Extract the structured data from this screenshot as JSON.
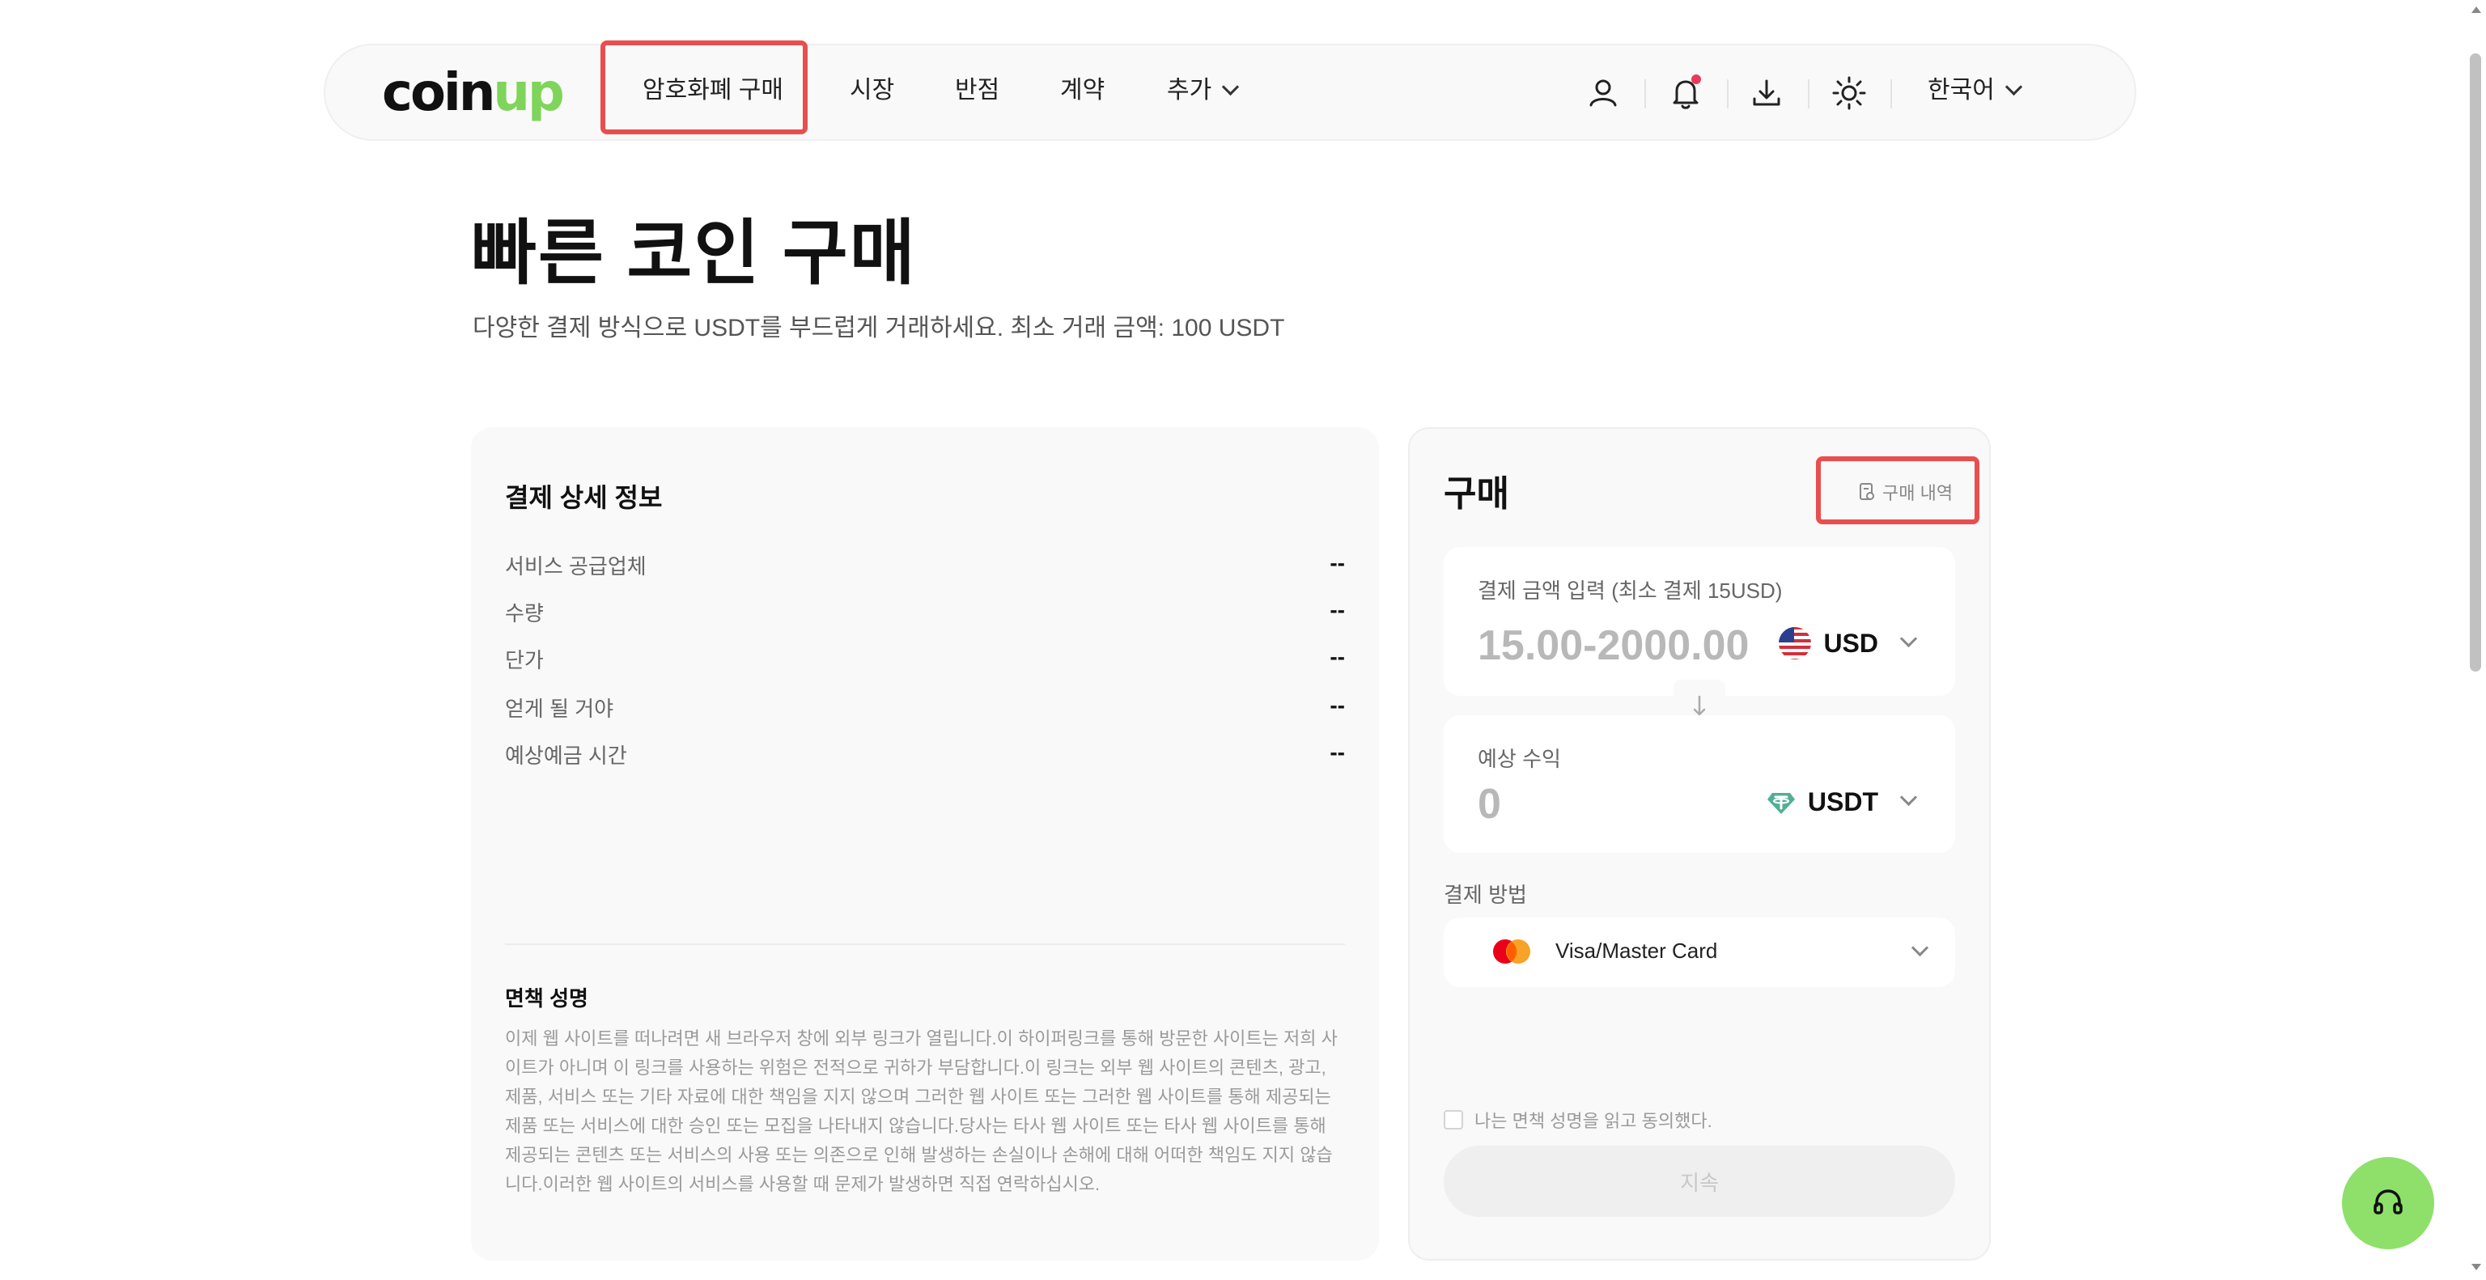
{
  "nav": {
    "logo_coin": "coin",
    "logo_up": "up",
    "items": [
      "암호화폐 구매",
      "시장",
      "반점",
      "계약",
      "추가"
    ],
    "language": "한국어"
  },
  "header": {
    "title": "빠른 코인 구매",
    "subtitle": "다양한 결제 방식으로 USDT를 부드럽게 거래하세요. 최소 거래 금액: 100 USDT"
  },
  "details": {
    "title": "결제 상세 정보",
    "rows": [
      {
        "label": "서비스 공급업체",
        "value": "--"
      },
      {
        "label": "수량",
        "value": "--"
      },
      {
        "label": "단가",
        "value": "--"
      },
      {
        "label": "얻게 될 거야",
        "value": "--"
      },
      {
        "label": "예상예금 시간",
        "value": "--"
      }
    ],
    "disclaimer_title": "면책 성명",
    "disclaimer_text": "이제 웹 사이트를 떠나려면 새 브라우저 창에 외부 링크가 열립니다.이 하이퍼링크를 통해 방문한 사이트는 저희 사이트가 아니며 이 링크를 사용하는 위험은 전적으로 귀하가 부담합니다.이 링크는 외부 웹 사이트의 콘텐츠, 광고, 제품, 서비스 또는 기타 자료에 대한 책임을 지지 않으며 그러한 웹 사이트 또는 그러한 웹 사이트를 통해 제공되는 제품 또는 서비스에 대한 승인 또는 모집을 나타내지 않습니다.당사는 타사 웹 사이트 또는 타사 웹 사이트를 통해 제공되는 콘텐츠 또는 서비스의 사용 또는 의존으로 인해 발생하는 손실이나 손해에 대해 어떠한 책임도 지지 않습니다.이러한 웹 사이트의 서비스를 사용할 때 문제가 발생하면 직접 연락하십시오."
  },
  "buy": {
    "title": "구매",
    "history_label": "구매 내역",
    "pay_label": "결제 금액 입력 (최소 결제 15USD)",
    "pay_placeholder": "15.00-2000.00",
    "pay_currency": "USD",
    "receive_label": "예상 수익",
    "receive_value": "0",
    "receive_currency": "USDT",
    "method_label": "결제 방법",
    "method_value": "Visa/Master Card",
    "agree_label": "나는 면책 성명을 읽고 동의했다.",
    "continue_label": "지속"
  },
  "colors": {
    "brand_green": "#7ed55a",
    "highlight_red": "#e94e4e",
    "support_green": "#8ee06a"
  }
}
